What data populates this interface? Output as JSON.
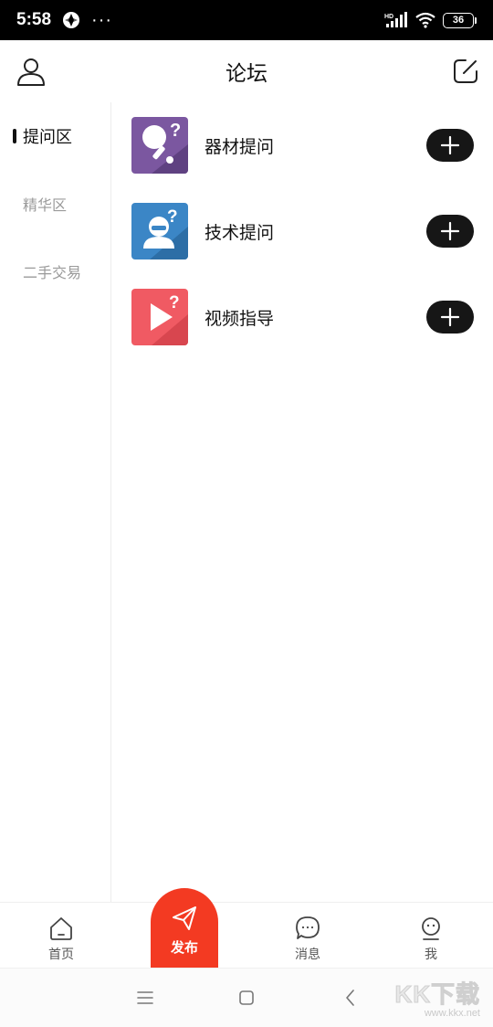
{
  "status_bar": {
    "time": "5:58",
    "more": "···",
    "network_label": "HD",
    "battery": "36"
  },
  "header": {
    "title": "论坛",
    "left_icon": "user-icon",
    "right_icon": "edit-icon"
  },
  "sidebar": {
    "items": [
      {
        "label": "提问区",
        "active": true
      },
      {
        "label": "精华区",
        "active": false
      },
      {
        "label": "二手交易",
        "active": false
      }
    ]
  },
  "categories": [
    {
      "label": "器材提问",
      "icon": "paddle-question-icon",
      "color": "#7b57a0"
    },
    {
      "label": "技术提问",
      "icon": "person-question-icon",
      "color": "#3b86c6"
    },
    {
      "label": "视频指导",
      "icon": "play-question-icon",
      "color": "#f05a63"
    }
  ],
  "bottom_nav": {
    "home": "首页",
    "publish": "发布",
    "messages": "消息",
    "me": "我"
  },
  "colors": {
    "accent": "#f33a22",
    "add_button": "#161616",
    "sidebar_inactive": "#9a9a9a"
  },
  "watermark": {
    "logo": "KK下载",
    "url": "www.kkx.net"
  }
}
